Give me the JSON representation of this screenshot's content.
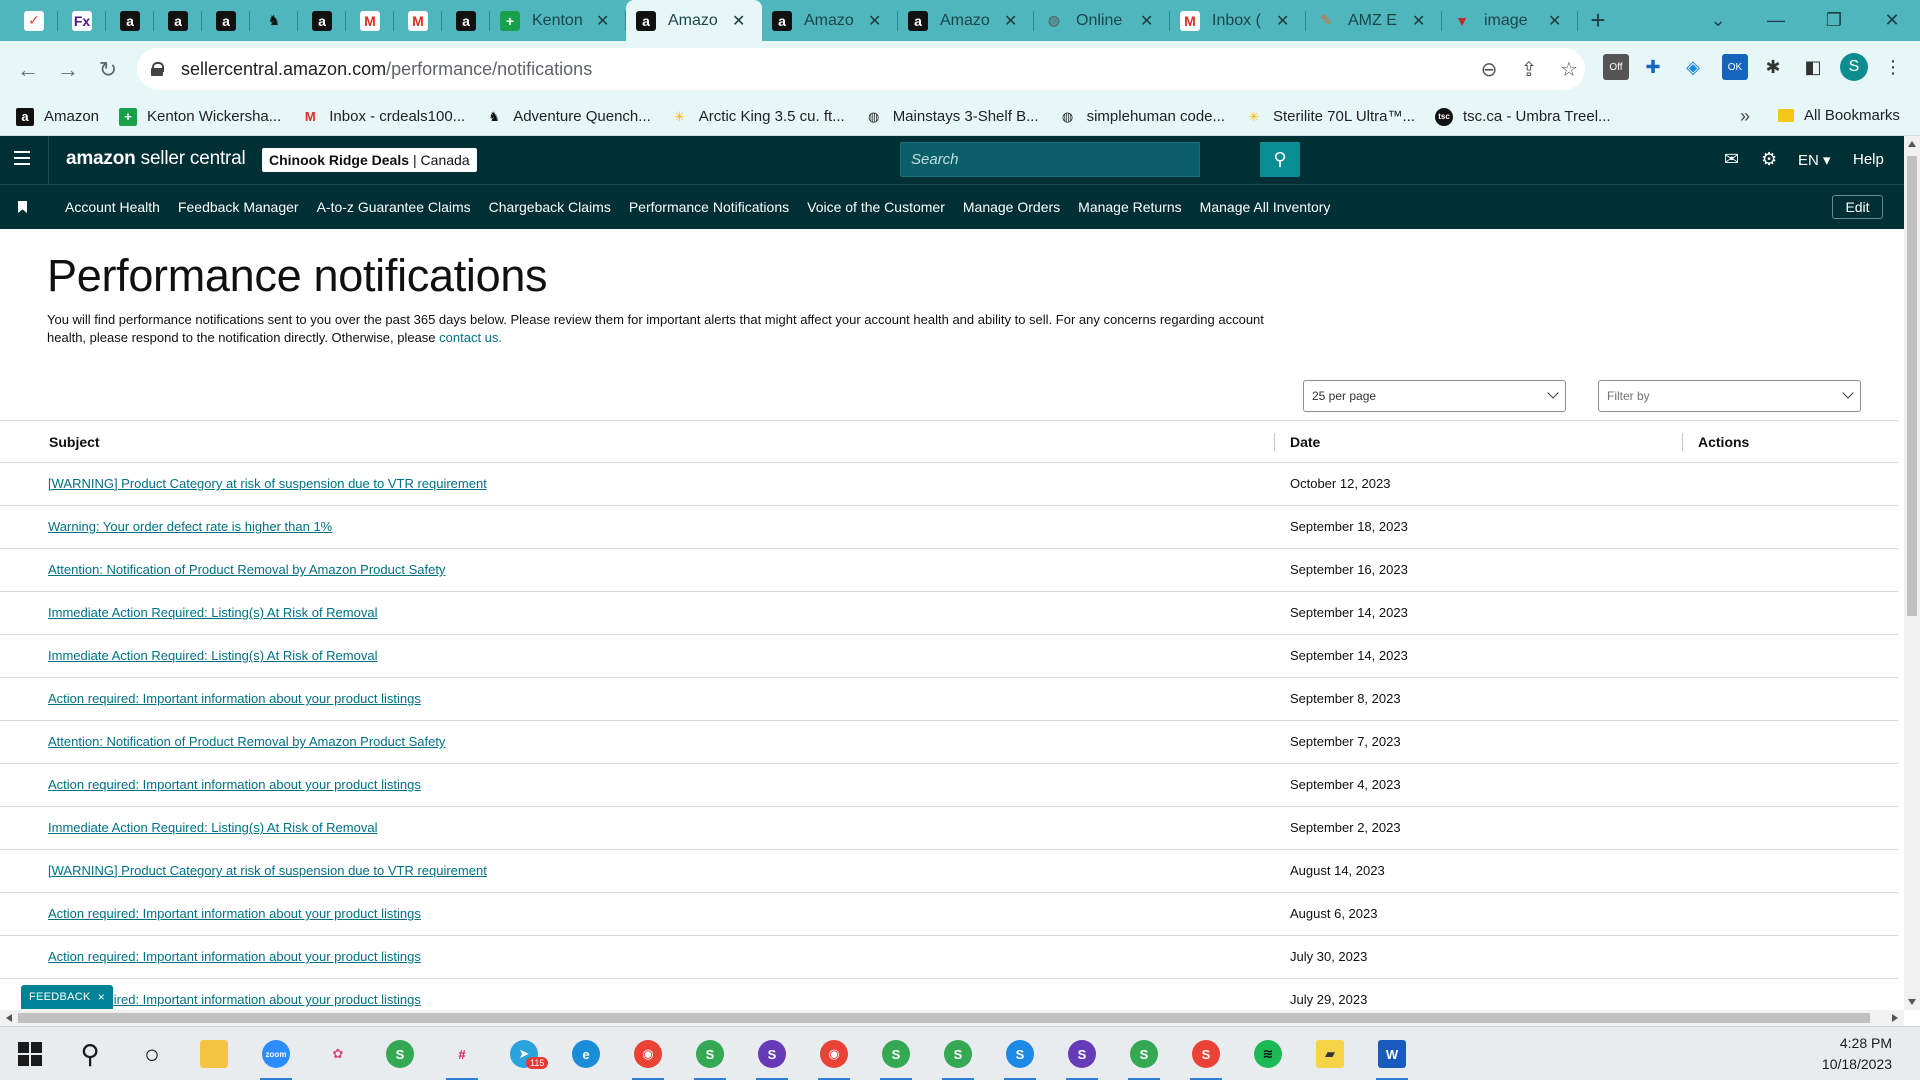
{
  "browser": {
    "tabs": [
      {
        "type": "small",
        "icon": "todoist-icon",
        "glyph": "✓",
        "bg": "#fff",
        "fg": "#db4035"
      },
      {
        "type": "small",
        "icon": "fedex-icon",
        "glyph": "Fx",
        "bg": "#fff",
        "fg": "#4d148c"
      },
      {
        "type": "small",
        "icon": "amazon-icon",
        "glyph": "a",
        "bg": "#111",
        "fg": "#fff"
      },
      {
        "type": "small",
        "icon": "amazon-icon",
        "glyph": "a",
        "bg": "#111",
        "fg": "#fff"
      },
      {
        "type": "small",
        "icon": "amazon-icon",
        "glyph": "a",
        "bg": "#111",
        "fg": "#fff"
      },
      {
        "type": "small",
        "icon": "moose-icon",
        "glyph": "♞",
        "bg": "transparent",
        "fg": "#111"
      },
      {
        "type": "small",
        "icon": "amazon-icon",
        "glyph": "a",
        "bg": "#111",
        "fg": "#fff"
      },
      {
        "type": "small",
        "icon": "gmail-icon",
        "glyph": "M",
        "bg": "#fff",
        "fg": "#d93025"
      },
      {
        "type": "small",
        "icon": "gmail-icon",
        "glyph": "M",
        "bg": "#fff",
        "fg": "#d93025"
      },
      {
        "type": "small",
        "icon": "amazon-icon",
        "glyph": "a",
        "bg": "#111",
        "fg": "#fff"
      },
      {
        "type": "wide",
        "icon": "sheets-plus-icon",
        "glyph": "+",
        "bg": "#19a04b",
        "fg": "#fff",
        "title": "Kenton",
        "active": false
      },
      {
        "type": "wide",
        "icon": "amazon-icon",
        "glyph": "a",
        "bg": "#111",
        "fg": "#fff",
        "title": "Amazo",
        "active": true
      },
      {
        "type": "wide",
        "icon": "amazon-icon",
        "glyph": "a",
        "bg": "#111",
        "fg": "#fff",
        "title": "Amazo",
        "active": false
      },
      {
        "type": "wide",
        "icon": "amazon-icon",
        "glyph": "a",
        "bg": "#111",
        "fg": "#fff",
        "title": "Amazo",
        "active": false
      },
      {
        "type": "wide",
        "icon": "globe-icon",
        "glyph": "◍",
        "bg": "transparent",
        "fg": "#555",
        "title": "Online",
        "active": false
      },
      {
        "type": "wide",
        "icon": "gmail-icon",
        "glyph": "M",
        "bg": "#fff",
        "fg": "#d93025",
        "title": "Inbox (",
        "active": false
      },
      {
        "type": "wide",
        "icon": "amz-ecom-icon",
        "glyph": "✎",
        "bg": "transparent",
        "fg": "#e96a2b",
        "title": "AMZ E(",
        "active": false
      },
      {
        "type": "wide",
        "icon": "image-icon",
        "glyph": "▼",
        "bg": "transparent",
        "fg": "#c62828",
        "title": "image",
        "active": false
      }
    ],
    "url_host": "sellercentral.amazon.com",
    "url_path": "/performance/notifications",
    "bookmarks": [
      {
        "label": "Amazon",
        "icon": "amazon-icon",
        "glyph": "a",
        "bg": "#111",
        "fg": "#fff"
      },
      {
        "label": "Kenton Wickersha...",
        "icon": "sheets-plus-icon",
        "glyph": "+",
        "bg": "#19a04b",
        "fg": "#fff"
      },
      {
        "label": "Inbox - crdeals100...",
        "icon": "gmail-icon",
        "glyph": "M",
        "bg": "transparent",
        "fg": "#d93025"
      },
      {
        "label": "Adventure Quench...",
        "icon": "moose-icon",
        "glyph": "♞",
        "bg": "transparent",
        "fg": "#111"
      },
      {
        "label": "Arctic King 3.5 cu. ft...",
        "icon": "walmart-icon",
        "glyph": "✳",
        "bg": "transparent",
        "fg": "#f5b400"
      },
      {
        "label": "Mainstays 3-Shelf B...",
        "icon": "globe-icon",
        "glyph": "◍",
        "bg": "transparent",
        "fg": "#222"
      },
      {
        "label": "simplehuman code...",
        "icon": "globe-icon",
        "glyph": "◍",
        "bg": "transparent",
        "fg": "#222"
      },
      {
        "label": "Sterilite 70L Ultra™...",
        "icon": "walmart-icon",
        "glyph": "✳",
        "bg": "transparent",
        "fg": "#f5b400"
      },
      {
        "label": "tsc.ca - Umbra Treel...",
        "icon": "tsc-icon",
        "glyph": "tsc",
        "bg": "#111",
        "fg": "#fff"
      }
    ],
    "all_bookmarks": "All Bookmarks",
    "profile_initial": "S"
  },
  "header": {
    "logo_main": "amazon",
    "logo_sub": "seller central",
    "store_name": "Chinook Ridge Deals",
    "store_region": "| Canada",
    "search_placeholder": "Search",
    "language": "EN ▾",
    "help": "Help"
  },
  "nav": {
    "items": [
      "Account Health",
      "Feedback Manager",
      "A-to-z Guarantee Claims",
      "Chargeback Claims",
      "Performance Notifications",
      "Voice of the Customer",
      "Manage Orders",
      "Manage Returns",
      "Manage All Inventory"
    ],
    "edit": "Edit"
  },
  "page": {
    "title": "Performance notifications",
    "intro": "You will find performance notifications sent to you over the past 365 days below. Please review them for important alerts that might affect your account health and ability to sell. For any concerns regarding account health, please respond to the notification directly. Otherwise, please ",
    "contact_link": "contact us.",
    "per_page": "25 per page",
    "filter_placeholder": "Filter by"
  },
  "table": {
    "headers": {
      "subject": "Subject",
      "date": "Date",
      "actions": "Actions"
    },
    "rows": [
      {
        "subject": "[WARNING] Product Category at risk of suspension due to VTR requirement",
        "date": "October 12, 2023"
      },
      {
        "subject": "Warning: Your order defect rate is higher than 1%",
        "date": "September 18, 2023"
      },
      {
        "subject": "Attention: Notification of Product Removal by Amazon Product Safety",
        "date": "September 16, 2023"
      },
      {
        "subject": "Immediate Action Required: Listing(s) At Risk of Removal",
        "date": "September 14, 2023"
      },
      {
        "subject": "Immediate Action Required: Listing(s) At Risk of Removal",
        "date": "September 14, 2023"
      },
      {
        "subject": "Action required: Important information about your product listings",
        "date": "September 8, 2023"
      },
      {
        "subject": "Attention: Notification of Product Removal by Amazon Product Safety",
        "date": "September 7, 2023"
      },
      {
        "subject": "Action required: Important information about your product listings",
        "date": "September 4, 2023"
      },
      {
        "subject": "Immediate Action Required: Listing(s) At Risk of Removal",
        "date": "September 2, 2023"
      },
      {
        "subject": "[WARNING] Product Category at risk of suspension due to VTR requirement",
        "date": "August 14, 2023"
      },
      {
        "subject": "Action required: Important information about your product listings",
        "date": "August 6, 2023"
      },
      {
        "subject": "Action required: Important information about your product listings",
        "date": "July 30, 2023"
      },
      {
        "subject": "Action required: Important information about your product listings",
        "date": "July 29, 2023"
      }
    ]
  },
  "feedback": {
    "label": "FEEDBACK",
    "close": "×"
  },
  "taskbar": {
    "apps": [
      {
        "name": "search-icon",
        "glyph": "⚲",
        "bg": "transparent",
        "fg": "#1a1a1a",
        "running": false
      },
      {
        "name": "cortana-icon",
        "glyph": "○",
        "bg": "transparent",
        "fg": "#1a1a1a",
        "running": false
      },
      {
        "name": "file-explorer-icon",
        "glyph": "▬",
        "bg": "#f4c542",
        "fg": "#f4c542",
        "running": false
      },
      {
        "name": "zoom-icon",
        "glyph": "zoom",
        "bg": "#2d8cff",
        "fg": "#fff",
        "running": true
      },
      {
        "name": "pinwheel-icon",
        "glyph": "✿",
        "bg": "transparent",
        "fg": "#e0457b",
        "running": false
      },
      {
        "name": "chrome-icon",
        "glyph": "S",
        "bg": "#34a853",
        "fg": "#fff",
        "running": false
      },
      {
        "name": "slack-icon",
        "glyph": "#",
        "bg": "transparent",
        "fg": "#e01e5a",
        "running": true
      },
      {
        "name": "telegram-icon",
        "glyph": "➤",
        "bg": "#2aa3df",
        "fg": "#fff",
        "running": false
      },
      {
        "name": "edge-icon",
        "glyph": "e",
        "bg": "#1a8dd8",
        "fg": "#fff",
        "running": false
      },
      {
        "name": "chrome-profile-icon",
        "glyph": "◉",
        "bg": "#ea4335",
        "fg": "#fff",
        "running": true
      },
      {
        "name": "chrome-profile-icon",
        "glyph": "S",
        "bg": "#34a853",
        "fg": "#fff",
        "running": true
      },
      {
        "name": "chrome-profile-icon",
        "glyph": "S",
        "bg": "#673ab7",
        "fg": "#fff",
        "running": true
      },
      {
        "name": "chrome-profile-icon",
        "glyph": "◉",
        "bg": "#ea4335",
        "fg": "#fff",
        "running": true
      },
      {
        "name": "chrome-profile-icon",
        "glyph": "S",
        "bg": "#34a853",
        "fg": "#fff",
        "running": true
      },
      {
        "name": "chrome-profile-icon",
        "glyph": "S",
        "bg": "#34a853",
        "fg": "#fff",
        "running": true
      },
      {
        "name": "chrome-profile-icon",
        "glyph": "S",
        "bg": "#1e88e5",
        "fg": "#fff",
        "running": true
      },
      {
        "name": "chrome-profile-icon",
        "glyph": "S",
        "bg": "#673ab7",
        "fg": "#fff",
        "running": true
      },
      {
        "name": "chrome-profile-icon",
        "glyph": "S",
        "bg": "#34a853",
        "fg": "#fff",
        "running": true
      },
      {
        "name": "chrome-profile-icon",
        "glyph": "S",
        "bg": "#ea4335",
        "fg": "#fff",
        "running": true
      },
      {
        "name": "spotify-icon",
        "glyph": "≋",
        "bg": "#1db954",
        "fg": "#111",
        "running": false
      },
      {
        "name": "sticky-notes-icon",
        "glyph": "▰",
        "bg": "#f7d348",
        "fg": "#333",
        "running": false
      },
      {
        "name": "word-icon",
        "glyph": "W",
        "bg": "#185abd",
        "fg": "#fff",
        "running": true
      }
    ],
    "telegram_badge": "115",
    "time": "4:28 PM",
    "date": "10/18/2023"
  }
}
